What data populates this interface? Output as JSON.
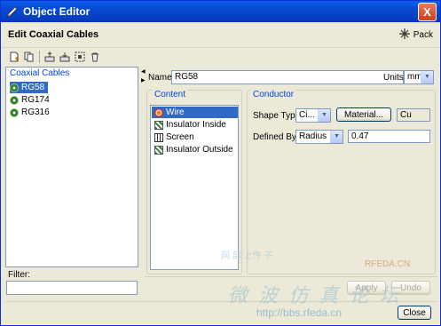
{
  "window": {
    "title": "Object Editor",
    "close_glyph": "X"
  },
  "header": {
    "title": "Edit Coaxial Cables",
    "pack_label": "Pack"
  },
  "toolbar": {
    "buttons": [
      "new-icon",
      "copy-icon",
      "export-icon",
      "import-icon",
      "select-icon",
      "delete-icon"
    ]
  },
  "cables": {
    "label": "Coaxial Cables",
    "items": [
      {
        "label": "RG58",
        "selected": true
      },
      {
        "label": "RG174",
        "selected": false
      },
      {
        "label": "RG316",
        "selected": false
      }
    ]
  },
  "filter": {
    "label": "Filter:",
    "value": ""
  },
  "details": {
    "name_label": "Name",
    "name_value": "RG58",
    "units_label": "Units:",
    "units_value": "mm"
  },
  "content": {
    "title": "Content",
    "items": [
      {
        "label": "Wire",
        "selected": true
      },
      {
        "label": "Insulator Inside",
        "selected": false
      },
      {
        "label": "Screen",
        "selected": false
      },
      {
        "label": "Insulator Outside",
        "selected": false
      }
    ]
  },
  "conductor": {
    "title": "Conductor",
    "shape_type_label": "Shape Type",
    "shape_type_value": "Ci...",
    "material_button": "Material...",
    "material_value": "Cu",
    "defined_by_label": "Defined By:",
    "defined_by_value": "Radius",
    "radius_value": "0.47"
  },
  "actions": {
    "apply": "Apply",
    "undo": "Undo",
    "close": "Close"
  },
  "watermark": {
    "line1": "网 部 上传 子",
    "brand": "RFEDA.CN",
    "cn": "微 波 仿 真 论 坛",
    "url": "http://bbs.rfeda.cn"
  }
}
